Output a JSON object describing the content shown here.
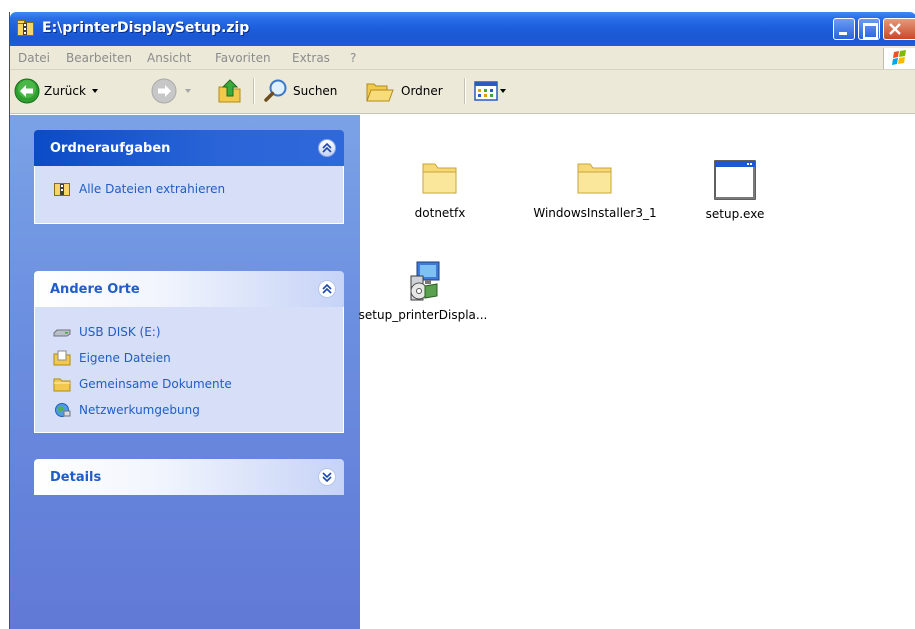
{
  "window": {
    "title": "E:\\printerDisplaySetup.zip"
  },
  "menu": [
    "Datei",
    "Bearbeiten",
    "Ansicht",
    "Favoriten",
    "Extras",
    "?"
  ],
  "toolbar": {
    "back_label": "Zurück",
    "search_label": "Suchen",
    "folders_label": "Ordner"
  },
  "tasks": {
    "title": "Ordneraufgaben",
    "items": [
      {
        "label": "Alle Dateien extrahieren",
        "icon": "zip-folder-icon"
      }
    ]
  },
  "places": {
    "title": "Andere Orte",
    "items": [
      {
        "label": "USB DISK (E:)",
        "icon": "drive-icon"
      },
      {
        "label": "Eigene Dateien",
        "icon": "my-documents-icon"
      },
      {
        "label": "Gemeinsame Dokumente",
        "icon": "folder-icon"
      },
      {
        "label": "Netzwerkumgebung",
        "icon": "network-icon"
      }
    ]
  },
  "details": {
    "title": "Details"
  },
  "files": [
    {
      "name": "dotnetfx",
      "icon": "folder-icon"
    },
    {
      "name": "WindowsInstaller3_1",
      "icon": "folder-icon"
    },
    {
      "name": "setup.exe",
      "icon": "application-icon"
    },
    {
      "name": "setup_printerDispla...",
      "icon": "installer-icon"
    }
  ],
  "colors": {
    "titlebar": "#1d5fdc",
    "menubar": "#ece9d8",
    "taskpane": "#6c8fe0",
    "link": "#215dc6"
  }
}
